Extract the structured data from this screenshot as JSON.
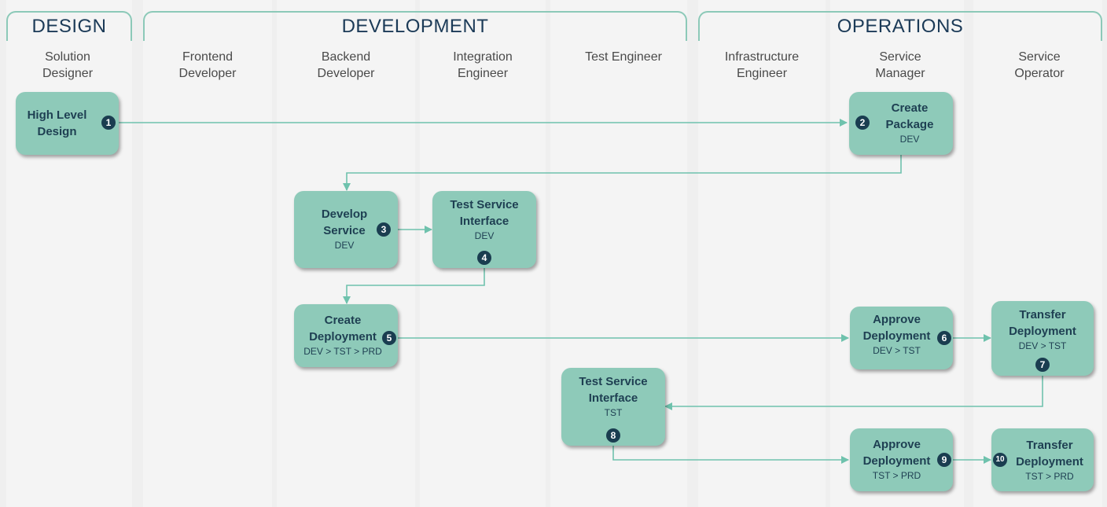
{
  "groups": [
    {
      "title": "DESIGN"
    },
    {
      "title": "DEVELOPMENT"
    },
    {
      "title": "OPERATIONS"
    }
  ],
  "roles": [
    "Solution\nDesigner",
    "Frontend\nDeveloper",
    "Backend\nDeveloper",
    "Integration\nEngineer",
    "Test Engineer",
    "Infrastructure\nEngineer",
    "Service\nManager",
    "Service\nOperator"
  ],
  "steps": [
    {
      "title": "High Level\nDesign",
      "sub": "",
      "num": "1"
    },
    {
      "title": "Create\nPackage",
      "sub": "DEV",
      "num": "2"
    },
    {
      "title": "Develop\nService",
      "sub": "DEV",
      "num": "3"
    },
    {
      "title": "Test Service\nInterface",
      "sub": "DEV",
      "num": "4"
    },
    {
      "title": "Create\nDeployment",
      "sub": "DEV > TST > PRD",
      "num": "5"
    },
    {
      "title": "Approve\nDeployment",
      "sub": "DEV > TST",
      "num": "6"
    },
    {
      "title": "Transfer\nDeployment",
      "sub": "DEV > TST",
      "num": "7"
    },
    {
      "title": "Test Service\nInterface",
      "sub": "TST",
      "num": "8"
    },
    {
      "title": "Approve\nDeployment",
      "sub": "TST > PRD",
      "num": "9"
    },
    {
      "title": "Transfer\nDeployment",
      "sub": "TST > PRD",
      "num": "10"
    }
  ],
  "colors": {
    "box": "#8ecab9",
    "badge": "#1a3d50",
    "connector": "#6fc2ad",
    "heading": "#1b3a57"
  }
}
